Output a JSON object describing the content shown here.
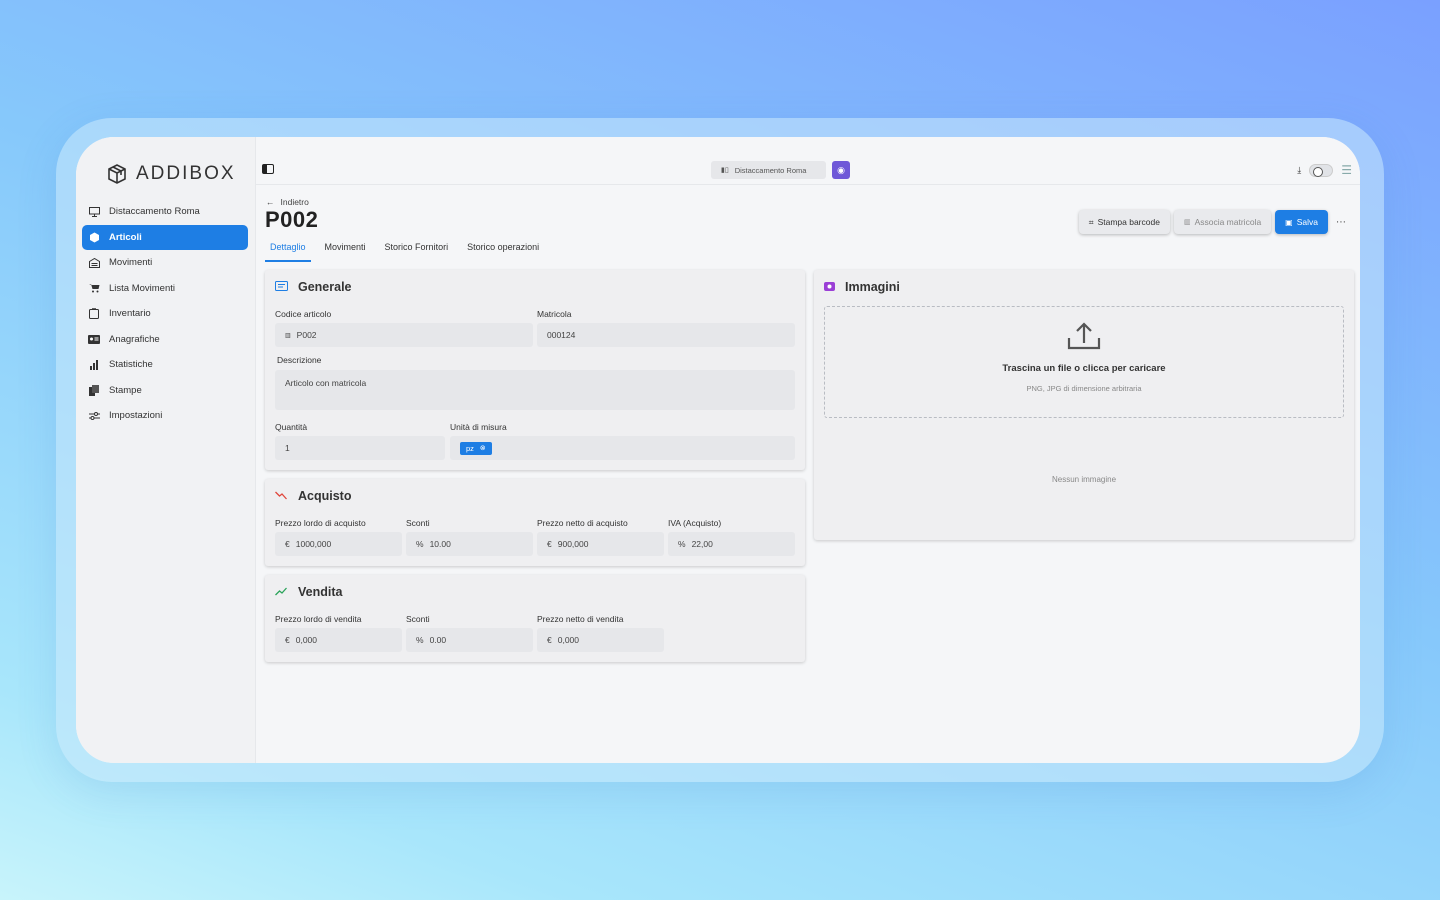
{
  "app": {
    "brand": "ADDIBOX"
  },
  "sidebar": {
    "items": [
      {
        "label": "Distaccamento Roma",
        "icon": "monitor-icon",
        "active": false
      },
      {
        "label": "Articoli",
        "icon": "cube-icon",
        "active": true
      },
      {
        "label": "Movimenti",
        "icon": "warehouse-icon",
        "active": false
      },
      {
        "label": "Lista Movimenti",
        "icon": "cart-icon",
        "active": false
      },
      {
        "label": "Inventario",
        "icon": "clipboard-icon",
        "active": false
      },
      {
        "label": "Anagrafiche",
        "icon": "id-card-icon",
        "active": false
      },
      {
        "label": "Statistiche",
        "icon": "bar-chart-icon",
        "active": false
      },
      {
        "label": "Stampe",
        "icon": "print-icon",
        "active": false
      },
      {
        "label": "Impostazioni",
        "icon": "sliders-icon",
        "active": false
      }
    ]
  },
  "topbar": {
    "store": "Distaccamento Roma"
  },
  "page": {
    "back": "Indietro",
    "title": "P002",
    "actions": {
      "barcode": "Stampa barcode",
      "associate": "Associa matricola",
      "save": "Salva"
    },
    "tabs": [
      "Dettaglio",
      "Movimenti",
      "Storico Fornitori",
      "Storico operazioni"
    ],
    "active_tab": 0
  },
  "generale": {
    "title": "Generale",
    "codice_label": "Codice articolo",
    "codice_value": "P002",
    "matricola_label": "Matricola",
    "matricola_value": "000124",
    "descrizione_label": "Descrizione",
    "descrizione_value": "Articolo con matricola",
    "quantita_label": "Quantità",
    "quantita_value": "1",
    "unita_label": "Unità di misura",
    "unita_value": "pz"
  },
  "acquisto": {
    "title": "Acquisto",
    "lordo_label": "Prezzo lordo di acquisto",
    "lordo_value": "1000,000",
    "sconti_label": "Sconti",
    "sconti_value": "10.00",
    "netto_label": "Prezzo netto di acquisto",
    "netto_value": "900,000",
    "iva_label": "IVA (Acquisto)",
    "iva_value": "22,00"
  },
  "vendita": {
    "title": "Vendita",
    "lordo_label": "Prezzo lordo di vendita",
    "lordo_value": "0,000",
    "sconti_label": "Sconti",
    "sconti_value": "0.00",
    "netto_label": "Prezzo netto di vendita",
    "netto_value": "0,000"
  },
  "immagini": {
    "title": "Immagini",
    "drop_title": "Trascina un file o clicca per caricare",
    "drop_sub": "PNG, JPG di dimensione arbitraria",
    "empty": "Nessun immagine"
  },
  "symbols": {
    "euro": "€",
    "percent": "%"
  },
  "colors": {
    "accent": "#1e7ee4",
    "store_button": "#6f58d8",
    "acquisto_icon": "#e0463c",
    "vendita_icon": "#2aa35a",
    "immagini_icon": "#9b3fd6"
  }
}
